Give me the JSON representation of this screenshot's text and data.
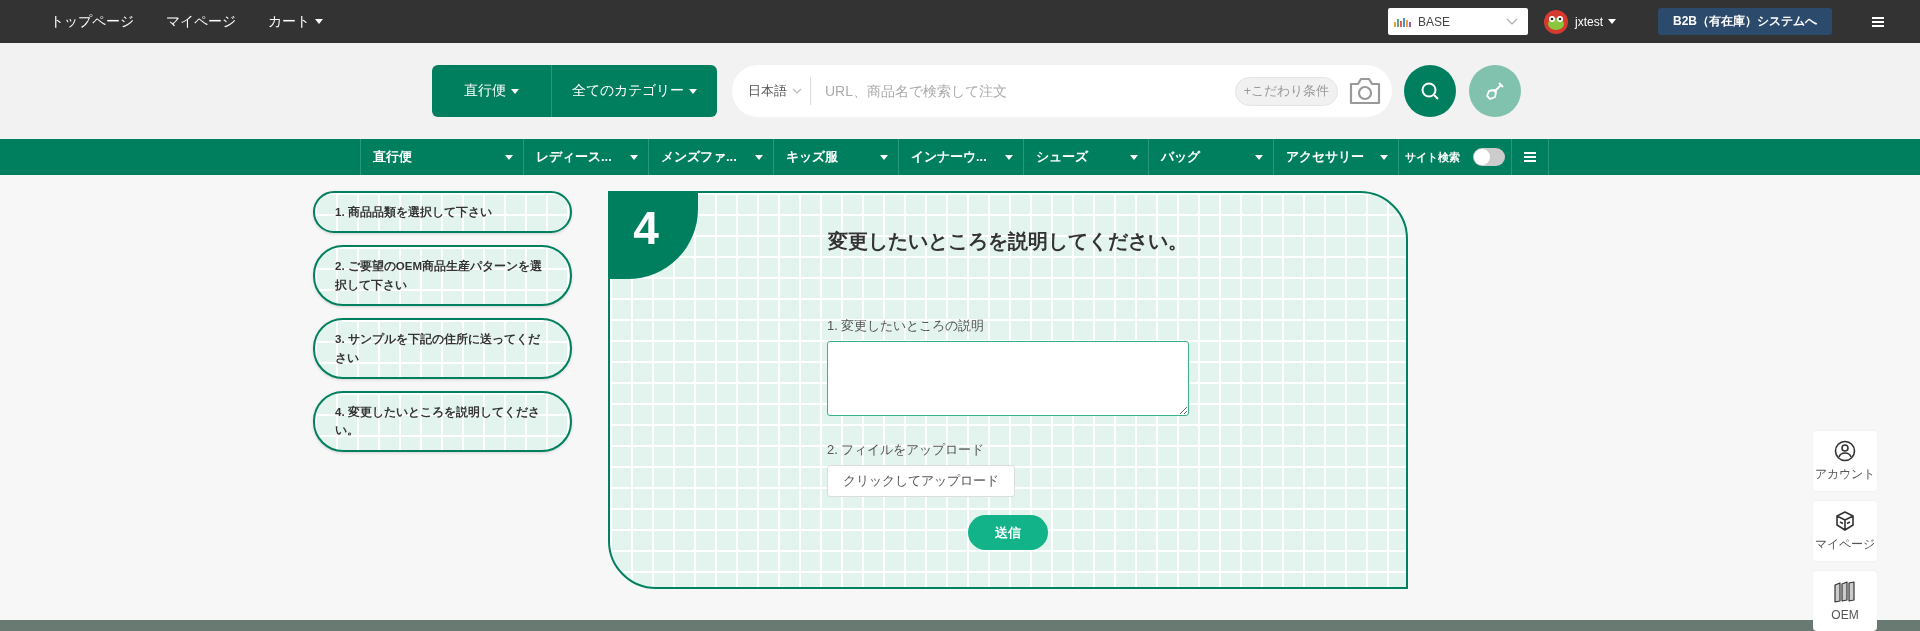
{
  "top_nav": {
    "links": [
      {
        "label": "トップページ",
        "dropdown": false
      },
      {
        "label": "マイページ",
        "dropdown": false
      },
      {
        "label": "カート",
        "dropdown": true
      }
    ],
    "store_select": {
      "value": "BASE"
    },
    "user": {
      "name": "jxtest"
    },
    "b2b_button": "B2B（有在庫）システムへ"
  },
  "search": {
    "shipping": "直行便",
    "category": "全てのカテゴリー",
    "language": "日本語",
    "placeholder": "URL、商品名で検索して注文",
    "filter_button": "+こだわり条件"
  },
  "category_nav": {
    "items": [
      "直行便",
      "レディース...",
      "メンズファ...",
      "キッズ服",
      "インナーウ...",
      "シューズ",
      "バッグ",
      "アクセサリー"
    ],
    "site_search": {
      "label": "サイト検索",
      "on": false
    }
  },
  "steps": [
    "1. 商品品類を選択して下さい",
    "2. ご要望のOEM商品生産パターンを選択して下さい",
    "3. サンプルを下記の住所に送ってください",
    "4. 変更したいところを説明してください。"
  ],
  "panel": {
    "number": "4",
    "title": "変更したいところを説明してください。",
    "fields": [
      {
        "kind": "textarea",
        "label": "1. 変更したいところの説明"
      },
      {
        "kind": "upload",
        "label": "2. フィイルをアップロード",
        "button": "クリックしてアップロード"
      }
    ],
    "submit": "送信"
  },
  "side_buttons": [
    {
      "kind": "account",
      "label": "アカウント"
    },
    {
      "kind": "box",
      "label": "マイページ"
    },
    {
      "kind": "oem",
      "label": "OEM"
    }
  ]
}
